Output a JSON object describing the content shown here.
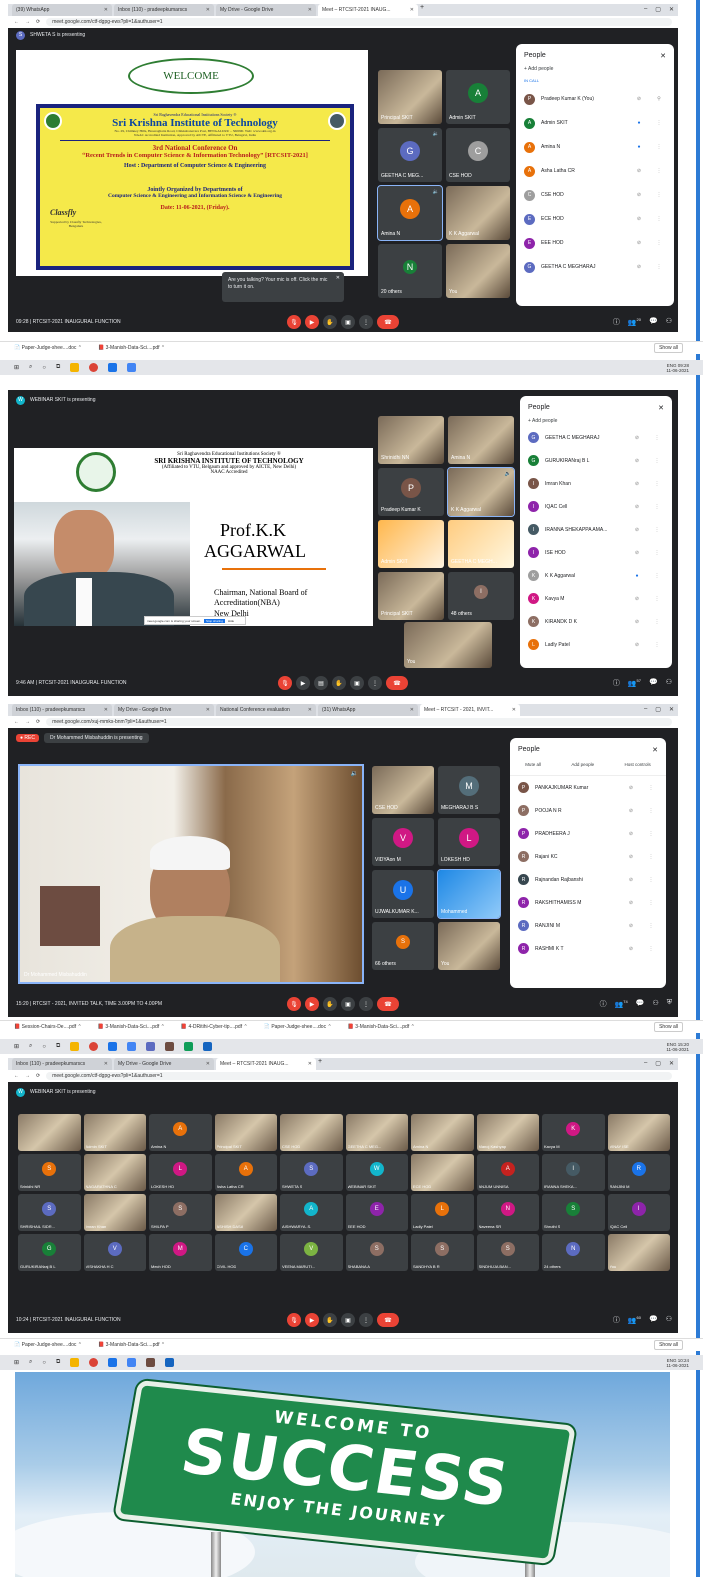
{
  "shot1": {
    "tabs": [
      "(39) WhatsApp",
      "Inbox (110) - pradeepkumarscs",
      "My Drive - Google Drive",
      "Meet – RTCSIT-2021 INAUG..."
    ],
    "url": "meet.google.com/ctf-dgpg-ews?pli=1&authuser=1",
    "presenter": "SHWETA S is presenting",
    "presenter_initial": "S",
    "slide": {
      "welcome": "WELCOME",
      "society": "Sri Raghavendra Educational Institutions Society ®",
      "college": "Sri Krishna Institute of Technology",
      "address": "No. 29, Chimney Hills, Hesaraghatta Road, Chikkabanavara Post, BENGALURU – 560090. Web: www.skit.org.in",
      "accredit": "NAAC Accredited Institution, Approved by AICTE, Affiliated to VTU, Belagavi, India",
      "conf_num": "3rd National Conference On",
      "conf_title": "“Recent Trends in Computer Science & Information Technology” [RTCSIT-2021]",
      "host": "Host : Department of Computer Science & Engineering",
      "sponsor": "Classfly",
      "sponsor_sub": "Supported by Classfly Technologies, Bengaluru",
      "jointly": "Jointly Organized by Departments of",
      "depts": "Computer Science & Engineering and Information Science & Engineering",
      "date": "Date: 11-06-2021, (Friday)."
    },
    "tiles": [
      {
        "name": "Principal SKIT"
      },
      {
        "name": "Admin SKIT"
      },
      {
        "name": "GEETHA C MEG...",
        "initial": "G"
      },
      {
        "name": "CSE HOD"
      },
      {
        "name": "Amina N",
        "initial": "A"
      },
      {
        "name": "K K Aggarwal"
      },
      {
        "name": "20 others"
      },
      {
        "name": "You"
      }
    ],
    "toast": "Are you talking? Your mic is off. Click the mic to turn it on.",
    "panel": {
      "title": "People",
      "add": "Add people",
      "incall": "IN CALL",
      "people": [
        {
          "name": "Pradeep Kumar K (You)",
          "initial": "P"
        },
        {
          "name": "Admin SKIT",
          "initial": "A"
        },
        {
          "name": "Amina N",
          "initial": "A"
        },
        {
          "name": "Asha Latha CR",
          "initial": "A"
        },
        {
          "name": "CSE HOD",
          "initial": "C"
        },
        {
          "name": "ECE HOD",
          "initial": "E"
        },
        {
          "name": "EEE HOD",
          "initial": "E"
        },
        {
          "name": "GEETHA C MEGHARAJ",
          "initial": "G"
        }
      ]
    },
    "time": "09:28",
    "meeting": "RTCSIT-2021 INAUGURAL FUNCTION",
    "count": "20",
    "downloads": [
      "Paper-Judge-shee....doc",
      "3-Manish-Data-Sci....pdf"
    ],
    "show_all": "Show all",
    "clock": "09:28",
    "clock_date": "11-06-2021",
    "lang": "ENG"
  },
  "shot2": {
    "presenter": "WEBINAR SKIT is presenting",
    "presenter_initial": "W",
    "slide": {
      "society": "Sri Raghavendra Educational Institutions Society ®",
      "college": "SRI KRISHNA INSTITUTE OF TECHNOLOGY",
      "affil": "(Affiliated to VTU, Belgaum and approved by AICTE, New Delhi)",
      "naac": "NAAC Accredited",
      "name1": "Prof.K.K",
      "name2": "AGGARWAL",
      "role1": "Chairman, National Board of",
      "role2": "Accreditation(NBA)",
      "city": "New Delhi",
      "mini": "meet.google.com is sharing your screen.",
      "stop": "Stop sharing",
      "hide": "Hide"
    },
    "tiles": [
      "Shrinidhi NN",
      "Amina N",
      "Pradeep Kumar K",
      "K K Aggarwal",
      "Admin SKIT",
      "GEETHA C MEGH...",
      "Principal SKIT",
      "48 others",
      "You"
    ],
    "panel": {
      "title": "People",
      "add": "Add people",
      "people": [
        {
          "name": "GEETHA C MEGHARAJ",
          "initial": "G"
        },
        {
          "name": "GURUKIRANraj B L",
          "initial": "G"
        },
        {
          "name": "Imran Khan",
          "initial": "I"
        },
        {
          "name": "IQAC Cell",
          "initial": "I"
        },
        {
          "name": "IRANNA SHEKAPPA AMA...",
          "initial": "I"
        },
        {
          "name": "ISE HOD",
          "initial": "I"
        },
        {
          "name": "K K Aggarwal",
          "initial": "K"
        },
        {
          "name": "Kavya M",
          "initial": "K"
        },
        {
          "name": "KIRANDK D K",
          "initial": "K"
        },
        {
          "name": "Ladly Patel",
          "initial": "L"
        }
      ]
    },
    "time": "9:46 AM",
    "meeting": "RTCSIT-2021 INAUGURAL FUNCTION",
    "count": "57"
  },
  "shot3": {
    "tabs": [
      "Inbox (110) - pradeepkumarscs",
      "My Drive - Google Drive",
      "National Conference evaluation",
      "(31) WhatsApp",
      "Meet – RTCSIT - 2021, INVIT..."
    ],
    "url": "meet.google.com/xuj-mmks-bnm?pli=1&authuser=1",
    "rec": "REC",
    "presenter": "Dr Mohammed Misbahuddin is presenting",
    "speaker": "Dr Mohammed Misbahuddin",
    "tiles": [
      {
        "name": "CSE HOD"
      },
      {
        "name": "MEGHARAJ B S",
        "initial": "M"
      },
      {
        "name": "VIDYAon M",
        "initial": "V"
      },
      {
        "name": "LOKESH HD",
        "initial": "L"
      },
      {
        "name": "UJWALKUMAR K...",
        "initial": "U"
      },
      {
        "name": "Mohammed"
      },
      {
        "name": "66 others"
      },
      {
        "name": "You"
      }
    ],
    "panel": {
      "title": "People",
      "actions": [
        "Mute all",
        "Add people",
        "Host controls"
      ],
      "people": [
        {
          "name": "PANKAJKUMAR Kumar",
          "initial": "P"
        },
        {
          "name": "POOJA N R",
          "initial": "P"
        },
        {
          "name": "PRADHEERA J",
          "initial": "P"
        },
        {
          "name": "Rajani KC",
          "initial": "R"
        },
        {
          "name": "Rajnandan Rajbanshi",
          "initial": "R"
        },
        {
          "name": "RAKSHITHAMISS M",
          "initial": "R"
        },
        {
          "name": "RANJINI M",
          "initial": "R"
        },
        {
          "name": "RASHMI K T",
          "initial": "R"
        }
      ]
    },
    "time": "15:20",
    "meeting": "RTCSIT - 2021, INVITED TALK, TIME 3.00PM TO 4.00PM",
    "count": "74",
    "downloads": [
      "Session-Chairs-De....pdf",
      "3-Manish-Data-Sci....pdf",
      "4-DRitihi-Cyber-tip....pdf",
      "Paper-Judge-shee....doc",
      "3-Manish-Data-Sci....pdf"
    ],
    "show_all": "Show all",
    "clock": "15:20",
    "clock_date": "11-06-2021",
    "lang": "ENG"
  },
  "shot4": {
    "tabs": [
      "Inbox (110) - pradeepkumarscs",
      "My Drive - Google Drive",
      "Meet – RTCSIT-2021 INAUG..."
    ],
    "url": "meet.google.com/ctf-dgpg-ews?pli=1&authuser=1",
    "presenter": "WEBINAR SKIT is presenting",
    "presenter_initial": "W",
    "grid": [
      {
        "name": "",
        "photo": true
      },
      {
        "name": "Admin SKIT",
        "photo": true
      },
      {
        "name": "Amina N",
        "initial": "A",
        "color": "#e8710a"
      },
      {
        "name": "Principal SKIT",
        "photo": true
      },
      {
        "name": "CSE HOD",
        "photo": true
      },
      {
        "name": "GEETHA C MEG...",
        "photo": true
      },
      {
        "name": "Amina N",
        "photo": true
      },
      {
        "name": "Manoj Kashyap",
        "photo": true
      },
      {
        "name": "Kavya M",
        "initial": "K",
        "color": "#d01884"
      },
      {
        "name": "VINAY ISE",
        "photo": true
      },
      {
        "name": "Srinidhi NR",
        "initial": "S",
        "color": "#e8710a"
      },
      {
        "name": "NAGARATHNA C",
        "photo": true
      },
      {
        "name": "LOKESH HD",
        "initial": "L",
        "color": "#d01884"
      },
      {
        "name": "Asha Latha CR",
        "initial": "A",
        "color": "#e8710a"
      },
      {
        "name": "SHWETA S",
        "initial": "S",
        "color": "#5c6bc0"
      },
      {
        "name": "WEBINAR SKIT",
        "initial": "W",
        "color": "#12b5cb"
      },
      {
        "name": "ECE HOD",
        "photo": true
      },
      {
        "name": "ANJUM UNNISA",
        "initial": "A",
        "color": "#c5221f"
      },
      {
        "name": "IRANNA SHEKA...",
        "initial": "I",
        "color": "#455a64"
      },
      {
        "name": "RANJINI M",
        "initial": "R",
        "color": "#1a73e8"
      },
      {
        "name": "SHRISHAIL SIDR...",
        "initial": "S",
        "color": "#5c6bc0"
      },
      {
        "name": "Imran Khan",
        "photo": true
      },
      {
        "name": "SHILPA P",
        "initial": "S",
        "color": "#8d6e63"
      },
      {
        "name": "ASHISH DASA",
        "photo": true
      },
      {
        "name": "AISHWARYA .S.",
        "initial": "A",
        "color": "#12b5cb"
      },
      {
        "name": "EEE HOD",
        "initial": "E",
        "color": "#8e24aa"
      },
      {
        "name": "Ladly Patel",
        "initial": "L",
        "color": "#e8710a"
      },
      {
        "name": "Naveena SR",
        "initial": "N",
        "color": "#d01884"
      },
      {
        "name": "Shruthi S",
        "initial": "S",
        "color": "#188038"
      },
      {
        "name": "IQAC Cell",
        "initial": "I",
        "color": "#8e24aa"
      },
      {
        "name": "GURUKIRANraj B L",
        "initial": "G",
        "color": "#188038"
      },
      {
        "name": "VISHAKHA H C",
        "initial": "V",
        "color": "#5c6bc0"
      },
      {
        "name": "Mech HOD",
        "initial": "M",
        "color": "#d01884"
      },
      {
        "name": "CIVIL HOD",
        "initial": "C",
        "color": "#1a73e8"
      },
      {
        "name": "VEENA MARUTI...",
        "initial": "V",
        "color": "#7cb342"
      },
      {
        "name": "SHABANA A",
        "initial": "S",
        "color": "#8d6e63"
      },
      {
        "name": "SANDHYA B R",
        "initial": "S",
        "color": "#8d6e63"
      },
      {
        "name": "SINDHUJA BAN...",
        "initial": "S",
        "color": "#8d6e63"
      },
      {
        "name": "24 others",
        "initial": "N",
        "color": "#5c6bc0"
      },
      {
        "name": "You",
        "photo": true
      }
    ],
    "time": "10:24",
    "meeting": "RTCSIT-2021 INAUGURAL FUNCTION",
    "count": "60",
    "downloads": [
      "Paper-Judge-shee....doc",
      "3-Manish-Data-Sci....pdf"
    ],
    "show_all": "Show all",
    "clock": "10:24",
    "clock_date": "11-06-2021",
    "lang": "ENG"
  },
  "banner": {
    "line1": "WELCOME TO",
    "line2": "SUCCESS",
    "line3": "ENJOY THE JOURNEY"
  }
}
